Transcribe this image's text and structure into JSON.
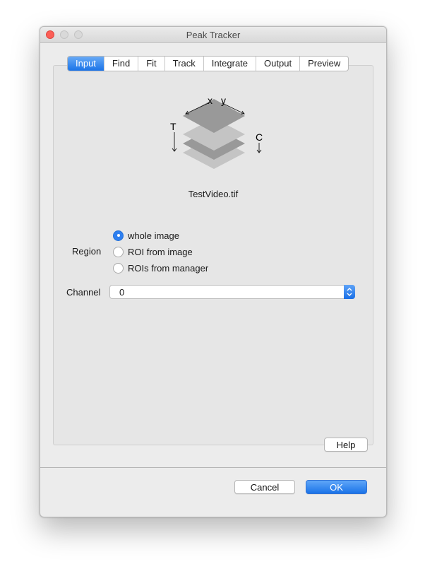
{
  "window": {
    "title": "Peak Tracker"
  },
  "tabs": [
    {
      "label": "Input",
      "active": true
    },
    {
      "label": "Find",
      "active": false
    },
    {
      "label": "Fit",
      "active": false
    },
    {
      "label": "Track",
      "active": false
    },
    {
      "label": "Integrate",
      "active": false
    },
    {
      "label": "Output",
      "active": false
    },
    {
      "label": "Preview",
      "active": false
    }
  ],
  "stack_icon": {
    "x_label": "x",
    "y_label": "y",
    "t_label": "T",
    "c_label": "C"
  },
  "input": {
    "filename": "TestVideo.tif",
    "region_label": "Region",
    "region_options": [
      {
        "label": "whole image",
        "selected": true
      },
      {
        "label": "ROI from image",
        "selected": false
      },
      {
        "label": "ROIs from manager",
        "selected": false
      }
    ],
    "channel_label": "Channel",
    "channel_value": "0"
  },
  "buttons": {
    "help": "Help",
    "cancel": "Cancel",
    "ok": "OK"
  },
  "colors": {
    "accent": "#1a73e8",
    "close_button": "#fc5f57"
  }
}
